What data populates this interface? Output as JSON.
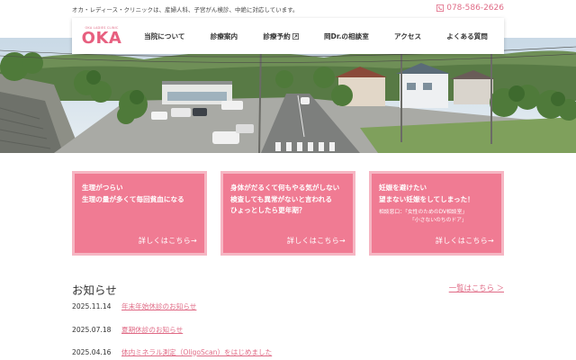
{
  "header": {
    "tagline": "オカ・レディース・クリニックは、産婦人科、子宮がん検診、中絶に対応しています。",
    "phone": "078-586-2626"
  },
  "logo": {
    "sub": "OKA LADIES CLINIC",
    "main": "OKA"
  },
  "nav": {
    "items": [
      {
        "label": "当院について"
      },
      {
        "label": "診療案内"
      },
      {
        "label": "診療予約"
      },
      {
        "label": "岡Dr.の相談室"
      },
      {
        "label": "アクセス"
      },
      {
        "label": "よくある質問"
      }
    ]
  },
  "cards": [
    {
      "lines": [
        "生理がつらい",
        "生理の量が多くて毎回貧血になる"
      ],
      "more": "詳しくはこちら→"
    },
    {
      "lines": [
        "身体がだるくて何もやる気がしない",
        "検査しても異常がないと言われる",
        "ひょっとしたら更年期？"
      ],
      "more": "詳しくはこちら→"
    },
    {
      "lines": [
        "妊娠を避けたい",
        "望まない妊娠をしてしまった！"
      ],
      "notes": [
        "相談窓口：「女性のためのDV相談室」",
        "「小さないのちのドア」"
      ],
      "more": "詳しくはこちら→"
    }
  ],
  "news": {
    "title": "お知らせ",
    "all_link": "一覧はこちら ＞",
    "items": [
      {
        "date": "2025.11.14",
        "title": "年末年始休診のお知らせ"
      },
      {
        "date": "2025.07.18",
        "title": "夏期休診のお知らせ"
      },
      {
        "date": "2025.04.16",
        "title": "体内ミネラル測定（OligoScan）をはじめました"
      }
    ]
  },
  "colors": {
    "accent": "#e06b86",
    "card_bg": "#f07b93",
    "card_border": "#f6b6c3"
  }
}
